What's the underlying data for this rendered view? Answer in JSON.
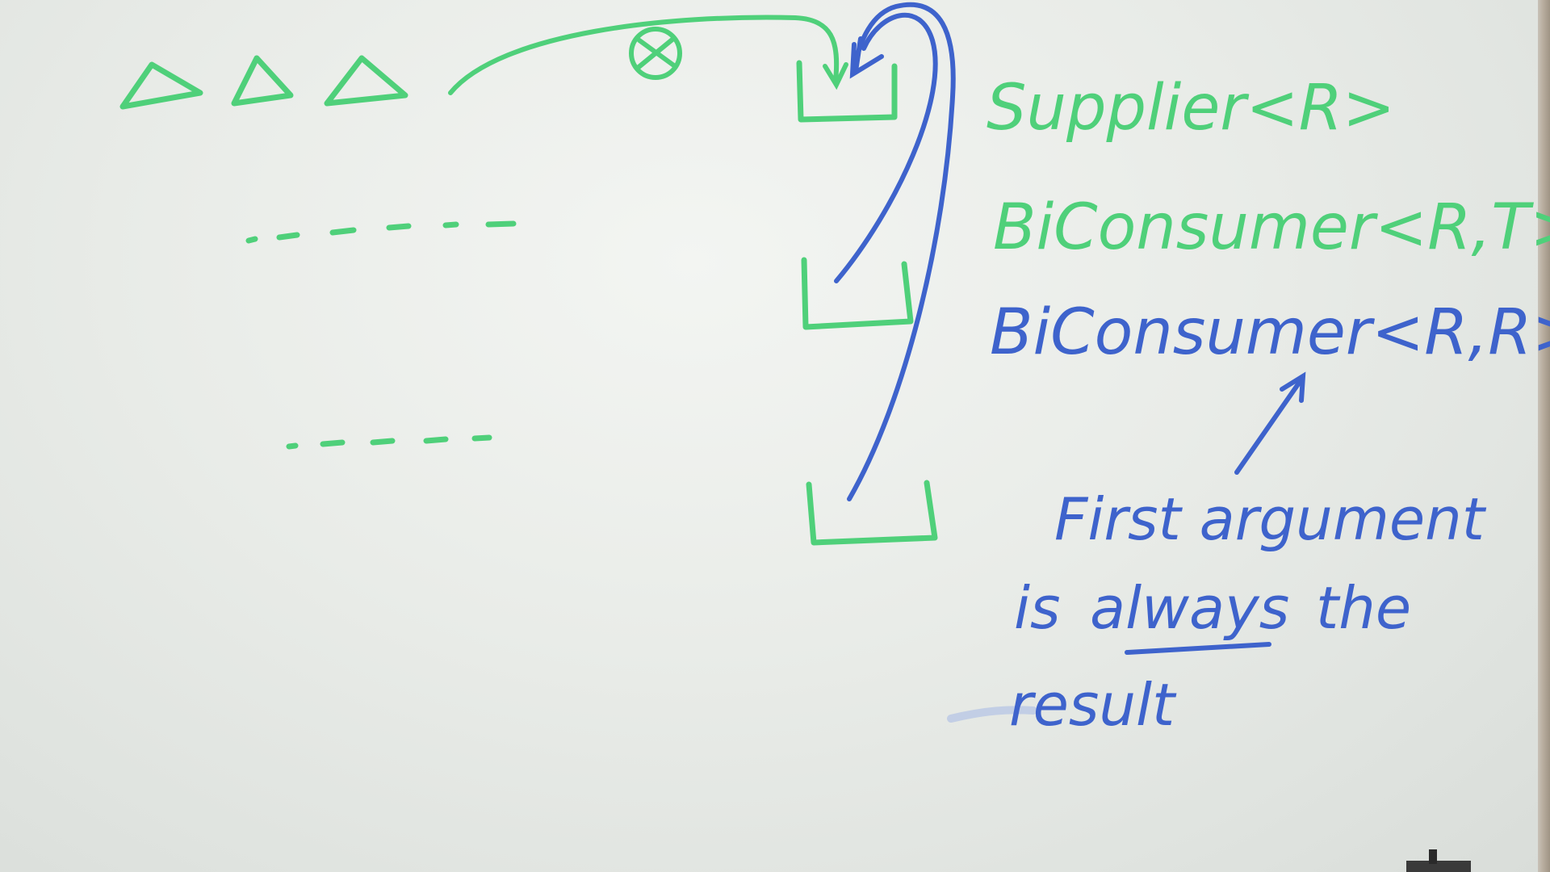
{
  "colors": {
    "green": "#4fd07a",
    "blue": "#3e63cc"
  },
  "labels": {
    "supplier": "Supplier<R>",
    "biconsumer_rt": "BiConsumer<R,T>",
    "biconsumer_rr": "BiConsumer<R,R>",
    "note_line1": "First argument",
    "note_line2_a": "is",
    "note_line2_b": "always",
    "note_line2_c": "the",
    "note_line3": "result"
  }
}
